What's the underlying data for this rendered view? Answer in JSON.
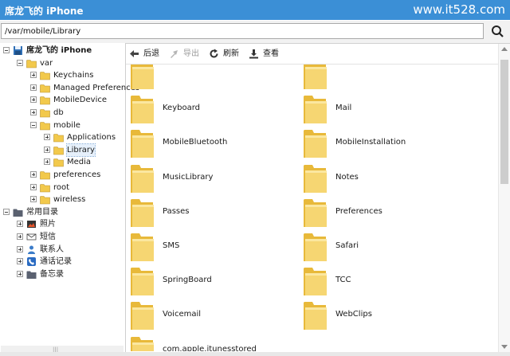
{
  "window": {
    "title": "席龙飞的 iPhone",
    "watermark": "www.it528.com"
  },
  "path": {
    "value": "/var/mobile/Library"
  },
  "tree": [
    {
      "label": "席龙飞的 iPhone",
      "level": 0,
      "icon": "device-icon",
      "exp": "minus",
      "bold": true
    },
    {
      "label": "var",
      "level": 1,
      "icon": "folder-icon",
      "exp": "minus"
    },
    {
      "label": "Keychains",
      "level": 2,
      "icon": "folder-icon",
      "exp": "plus"
    },
    {
      "label": "Managed Preferences",
      "level": 2,
      "icon": "folder-icon",
      "exp": "plus"
    },
    {
      "label": "MobileDevice",
      "level": 2,
      "icon": "folder-icon",
      "exp": "plus"
    },
    {
      "label": "db",
      "level": 2,
      "icon": "folder-icon",
      "exp": "plus"
    },
    {
      "label": "mobile",
      "level": 2,
      "icon": "folder-icon",
      "exp": "minus"
    },
    {
      "label": "Applications",
      "level": 3,
      "icon": "folder-icon",
      "exp": "plus"
    },
    {
      "label": "Library",
      "level": 3,
      "icon": "folder-icon",
      "exp": "plus",
      "selected": true
    },
    {
      "label": "Media",
      "level": 3,
      "icon": "folder-icon",
      "exp": "plus"
    },
    {
      "label": "preferences",
      "level": 2,
      "icon": "folder-icon",
      "exp": "plus"
    },
    {
      "label": "root",
      "level": 2,
      "icon": "folder-icon",
      "exp": "plus"
    },
    {
      "label": "wireless",
      "level": 2,
      "icon": "folder-icon",
      "exp": "plus"
    },
    {
      "label": "常用目录",
      "level": 0,
      "icon": "folder-dark-icon",
      "exp": "minus"
    },
    {
      "label": "照片",
      "level": 1,
      "icon": "photo-icon",
      "exp": "plus"
    },
    {
      "label": "短信",
      "level": 1,
      "icon": "message-icon",
      "exp": "plus"
    },
    {
      "label": "联系人",
      "level": 1,
      "icon": "contacts-icon",
      "exp": "plus"
    },
    {
      "label": "通话记录",
      "level": 1,
      "icon": "phone-icon",
      "exp": "plus"
    },
    {
      "label": "备忘录",
      "level": 1,
      "icon": "notes-icon",
      "exp": "plus"
    }
  ],
  "toolbar": {
    "back": "后退",
    "export": "导出",
    "refresh": "刷新",
    "view": "查看"
  },
  "files": [
    {
      "name": ""
    },
    {
      "name": ""
    },
    {
      "name": "Keyboard"
    },
    {
      "name": "Mail"
    },
    {
      "name": "MobileBluetooth"
    },
    {
      "name": "MobileInstallation"
    },
    {
      "name": "MusicLibrary"
    },
    {
      "name": "Notes"
    },
    {
      "name": "Passes"
    },
    {
      "name": "Preferences"
    },
    {
      "name": "SMS"
    },
    {
      "name": "Safari"
    },
    {
      "name": "SpringBoard"
    },
    {
      "name": "TCC"
    },
    {
      "name": "Voicemail"
    },
    {
      "name": "WebClips"
    },
    {
      "name": "com.apple.itunesstored"
    }
  ],
  "colors": {
    "titlebar": "#3b8fd6",
    "folder": "#f2c94c",
    "folder_dark": "#d9a92e"
  }
}
